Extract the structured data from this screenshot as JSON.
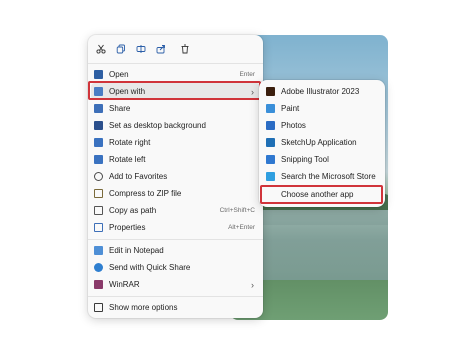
{
  "toolbar": {
    "cut_icon": "scissors-icon",
    "copy_icon": "copy-icon",
    "rename_icon": "rename-icon",
    "share_icon": "share-icon",
    "delete_icon": "trash-icon"
  },
  "menu": {
    "items": [
      {
        "label": "Open",
        "shortcut": "Enter",
        "icon": "image-icon",
        "color": "#2e5fa3"
      },
      {
        "label": "Open with",
        "shortcut": "",
        "icon": "open-with-icon",
        "color": "#4a7dc4"
      },
      {
        "label": "Share",
        "shortcut": "",
        "icon": "share-icon",
        "color": "#3d6fb8"
      },
      {
        "label": "Set as desktop background",
        "shortcut": "",
        "icon": "desktop-icon",
        "color": "#2b4f8c"
      },
      {
        "label": "Rotate right",
        "shortcut": "",
        "icon": "rotate-right-icon",
        "color": "#3a72c0"
      },
      {
        "label": "Rotate left",
        "shortcut": "",
        "icon": "rotate-left-icon",
        "color": "#3a72c0"
      },
      {
        "label": "Add to Favorites",
        "shortcut": "",
        "icon": "star-icon",
        "color": "#4a4a4a"
      },
      {
        "label": "Compress to ZIP file",
        "shortcut": "",
        "icon": "zip-icon",
        "color": "#7a6a3a"
      },
      {
        "label": "Copy as path",
        "shortcut": "Ctrl+Shift+C",
        "icon": "path-icon",
        "color": "#555555"
      },
      {
        "label": "Properties",
        "shortcut": "Alt+Enter",
        "icon": "properties-icon",
        "color": "#3d6fb8"
      },
      {
        "label": "Edit in Notepad",
        "shortcut": "",
        "icon": "notepad-icon",
        "color": "#4e8fd6"
      },
      {
        "label": "Send with Quick Share",
        "shortcut": "",
        "icon": "quick-share-icon",
        "color": "#2f7fd0"
      },
      {
        "label": "WinRAR",
        "shortcut": "",
        "icon": "winrar-icon",
        "color": "#8a3a6a"
      },
      {
        "label": "Show more options",
        "shortcut": "",
        "icon": "more-options-icon",
        "color": "#3a3a3a"
      }
    ]
  },
  "submenu": {
    "items": [
      {
        "label": "Adobe Illustrator 2023",
        "icon": "illustrator-icon",
        "color": "#3b1f0e"
      },
      {
        "label": "Paint",
        "icon": "paint-icon",
        "color": "#3a8fd9"
      },
      {
        "label": "Photos",
        "icon": "photos-icon",
        "color": "#2b6cc4"
      },
      {
        "label": "SketchUp Application",
        "icon": "sketchup-icon",
        "color": "#1f6fb5"
      },
      {
        "label": "Snipping Tool",
        "icon": "snipping-tool-icon",
        "color": "#2f78d0"
      },
      {
        "label": "Search the Microsoft Store",
        "icon": "store-icon",
        "color": "#2f9fe0"
      },
      {
        "label": "Choose another app",
        "icon": "",
        "color": ""
      }
    ]
  },
  "colors": {
    "highlight": "#d0343a",
    "menu_bg": "#f9f9f9"
  }
}
